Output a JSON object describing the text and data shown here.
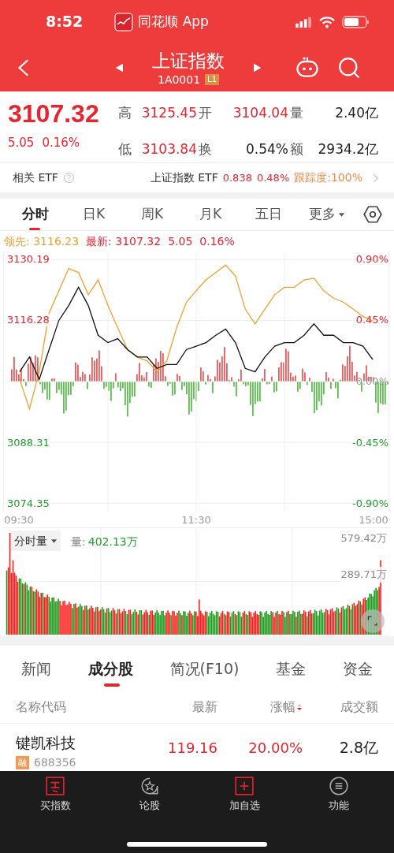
{
  "status_bar": {
    "time": "8:52",
    "app_title": "同花顺 App"
  },
  "header": {
    "title": "上证指数",
    "code": "1A0001",
    "level_badge": "L1"
  },
  "quote": {
    "price": "3107.32",
    "change": "5.05",
    "change_pct": "0.16%",
    "stats": [
      {
        "label": "高",
        "value": "3125.45",
        "color": "#e9232f"
      },
      {
        "label": "开",
        "value": "3104.04",
        "color": "#e9232f"
      },
      {
        "label": "量",
        "value": "2.40亿",
        "color": "#222222"
      },
      {
        "label": "低",
        "value": "3103.84",
        "color": "#e9232f"
      },
      {
        "label": "换",
        "value": "0.54%",
        "color": "#222222"
      },
      {
        "label": "额",
        "value": "2934.2亿",
        "color": "#222222"
      }
    ]
  },
  "etf": {
    "label": "相关 ETF",
    "name": "上证指数 ETF",
    "price": "0.838",
    "pct": "0.48%",
    "tracking": "跟踪度:100%"
  },
  "chart_tabs": [
    {
      "label": "分时",
      "selected": true,
      "kind": "tab"
    },
    {
      "label": "日K",
      "selected": false,
      "kind": "tab"
    },
    {
      "label": "周K",
      "selected": false,
      "kind": "tab"
    },
    {
      "label": "月K",
      "selected": false,
      "kind": "tab"
    },
    {
      "label": "五日",
      "selected": false,
      "kind": "tab"
    },
    {
      "label": "更多",
      "selected": false,
      "kind": "dropdown"
    }
  ],
  "chart": {
    "leader": "领先: 3116.23",
    "latest": "最新: 3107.32",
    "change": "5.05",
    "change_pct": "0.16%",
    "right_ticks": [
      {
        "label": "0.90%",
        "color": "#e9232f"
      },
      {
        "label": "0.45%",
        "color": "#e9232f"
      },
      {
        "label": "0.00%",
        "color": "#999999"
      },
      {
        "label": "-0.45%",
        "color": "#1e9e2a"
      },
      {
        "label": "-0.90%",
        "color": "#1e9e2a"
      }
    ],
    "chart_data": {
      "type": "line",
      "grid": true,
      "categories": [
        "09:30",
        null,
        null,
        null,
        null,
        null,
        null,
        null,
        null,
        null,
        null,
        null,
        null,
        null,
        null,
        null,
        null,
        null,
        "11:30",
        null,
        null,
        null,
        null,
        null,
        null,
        null,
        null,
        null,
        null,
        null,
        null,
        null,
        null,
        null,
        null,
        null,
        "15:00"
      ],
      "series": [
        {
          "color": "#f0a030",
          "values": [
            3102.8,
            3096.0,
            3104.5,
            3118.0,
            3123.1,
            3128.2,
            3127.3,
            3122.2,
            3125.6,
            3119.7,
            3114.6,
            3109.6,
            3107.9,
            3107.0,
            3104.5,
            3107.0,
            3114.6,
            3120.5,
            3123.1,
            3125.6,
            3127.3,
            3129.0,
            3126.5,
            3118.9,
            3115.5,
            3118.9,
            3122.2,
            3123.9,
            3123.9,
            3125.6,
            3126.0,
            3123.1,
            3121.4,
            3120.5,
            3118.9,
            3117.2,
            3116.2
          ]
        },
        {
          "color": "#111111",
          "values": [
            3104.5,
            3107.9,
            3102.8,
            3109.6,
            3116.3,
            3119.7,
            3123.9,
            3119.7,
            3112.9,
            3111.2,
            3112.1,
            3109.6,
            3107.9,
            3107.9,
            3105.3,
            3106.2,
            3106.2,
            3109.6,
            3110.4,
            3111.2,
            3112.9,
            3114.3,
            3111.2,
            3105.3,
            3104.5,
            3107.9,
            3110.4,
            3111.2,
            3111.2,
            3112.9,
            3115.5,
            3112.9,
            3112.9,
            3111.2,
            3111.2,
            3110.4,
            3107.3
          ]
        }
      ],
      "ylim": [
        3072.55,
        3131.99
      ],
      "yticks": [
        {
          "value": 3130.19,
          "label": "3130.19"
        },
        {
          "value": 3116.28,
          "label": "3116.28"
        },
        {
          "value": 3088.31,
          "label": "3088.31"
        },
        {
          "value": 3074.35,
          "label": "3074.35"
        }
      ]
    }
  },
  "volume": {
    "selector": "分时量",
    "label": "量:",
    "value": "402.13万",
    "ticks": [
      "579.42万",
      "289.71万"
    ]
  },
  "info_tabs": [
    {
      "label": "新闻",
      "selected": false
    },
    {
      "label": "成分股",
      "selected": true
    },
    {
      "label": "简况(F10)",
      "selected": false
    },
    {
      "label": "基金",
      "selected": false
    },
    {
      "label": "资金",
      "selected": false
    }
  ],
  "table": {
    "columns": [
      {
        "label": "名称代码",
        "sortable": false
      },
      {
        "label": "最新",
        "sortable": false
      },
      {
        "label": "涨幅",
        "sortable": true
      },
      {
        "label": "成交额",
        "sortable": false
      }
    ],
    "rows": [
      {
        "name": "键凯科技",
        "badge": "融",
        "code": "688356",
        "price": "119.16",
        "pct": "20.00%",
        "amount": "2.8亿"
      }
    ]
  },
  "bottom_nav": [
    {
      "label": "买指数",
      "kind": "buy"
    },
    {
      "label": "论股",
      "kind": "discuss"
    },
    {
      "label": "加自选",
      "kind": "add"
    },
    {
      "label": "功能",
      "kind": "menu"
    }
  ]
}
